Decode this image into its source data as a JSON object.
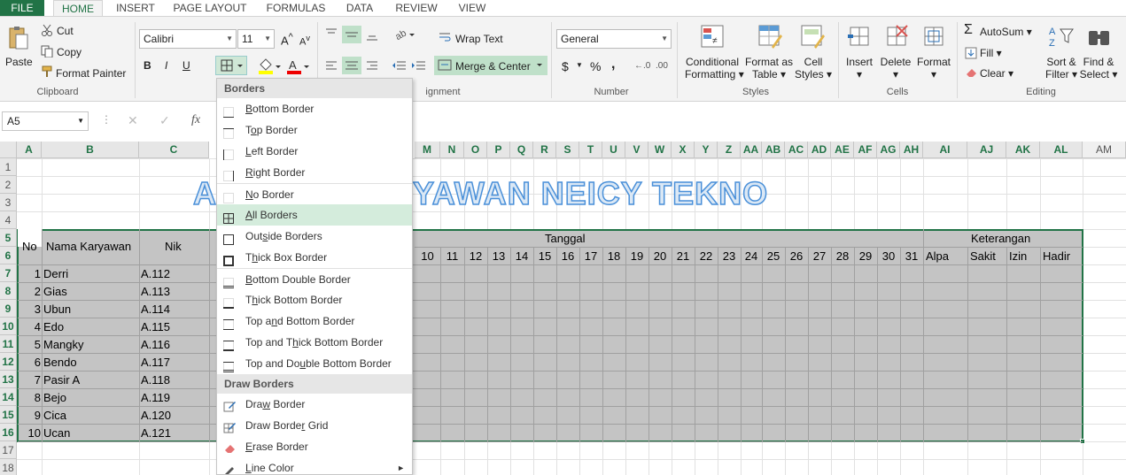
{
  "tabs": {
    "file": "FILE",
    "home": "HOME",
    "insert": "INSERT",
    "page_layout": "PAGE LAYOUT",
    "formulas": "FORMULAS",
    "data": "DATA",
    "review": "REVIEW",
    "view": "VIEW"
  },
  "clipboard": {
    "paste": "Paste",
    "cut": "Cut",
    "copy": "Copy",
    "format_painter": "Format Painter",
    "label": "Clipboard"
  },
  "font": {
    "name": "Calibri",
    "size": "11",
    "label": "Font",
    "bold": "B",
    "italic": "I",
    "underline": "U"
  },
  "alignment": {
    "wrap": "Wrap Text",
    "merge": "Merge & Center",
    "label": "Alignment"
  },
  "number": {
    "format": "General",
    "currency": "$",
    "percent": "%",
    "comma": ",",
    "label": "Number"
  },
  "styles": {
    "conditional": "Conditional",
    "conditional2": "Formatting",
    "format_as": "Format as",
    "format_as2": "Table",
    "cell": "Cell",
    "cell2": "Styles",
    "label": "Styles"
  },
  "cells": {
    "insert": "Insert",
    "delete": "Delete",
    "format": "Format",
    "label": "Cells"
  },
  "editing": {
    "autosum": "AutoSum",
    "fill": "Fill",
    "clear": "Clear",
    "sort": "Sort &",
    "sort2": "Filter",
    "find": "Find &",
    "find2": "Select",
    "label": "Editing"
  },
  "formula_bar": {
    "name_box": "A5",
    "fx": "fx"
  },
  "columns": [
    "A",
    "B",
    "C",
    "M",
    "N",
    "O",
    "P",
    "Q",
    "R",
    "S",
    "T",
    "U",
    "V",
    "W",
    "X",
    "Y",
    "Z",
    "AA",
    "AB",
    "AC",
    "AD",
    "AE",
    "AF",
    "AG",
    "AH",
    "AI",
    "AJ",
    "AK",
    "AL",
    "AM"
  ],
  "rows": [
    "1",
    "2",
    "3",
    "4",
    "5",
    "6",
    "7",
    "8",
    "9",
    "10",
    "11",
    "12",
    "13",
    "14",
    "15",
    "16",
    "17",
    "18"
  ],
  "sheet": {
    "title_left": "A",
    "title_right": "YAWAN NEICY TEKNO",
    "hdr_no": "No",
    "hdr_nama": "Nama Karyawan",
    "hdr_nik": "Nik",
    "hdr_tanggal": "Tanggal",
    "hdr_keterangan": "Keterangan",
    "days": [
      "10",
      "11",
      "12",
      "13",
      "14",
      "15",
      "16",
      "17",
      "18",
      "19",
      "20",
      "21",
      "22",
      "23",
      "24",
      "25",
      "26",
      "27",
      "28",
      "29",
      "30",
      "31"
    ],
    "ket": [
      "Alpa",
      "Sakit",
      "Izin",
      "Hadir"
    ],
    "employees": [
      {
        "no": "1",
        "nama": "Derri",
        "nik": "A.112"
      },
      {
        "no": "2",
        "nama": "Gias",
        "nik": "A.113"
      },
      {
        "no": "3",
        "nama": "Ubun",
        "nik": "A.114"
      },
      {
        "no": "4",
        "nama": "Edo",
        "nik": "A.115"
      },
      {
        "no": "5",
        "nama": "Mangky",
        "nik": "A.116"
      },
      {
        "no": "6",
        "nama": "Bendo",
        "nik": "A.117"
      },
      {
        "no": "7",
        "nama": "Pasir A",
        "nik": "A.118"
      },
      {
        "no": "8",
        "nama": "Bejo",
        "nik": "A.119"
      },
      {
        "no": "9",
        "nama": "Cica",
        "nik": "A.120"
      },
      {
        "no": "10",
        "nama": "Ucan",
        "nik": "A.121"
      }
    ]
  },
  "menu": {
    "borders_header": "Borders",
    "items": [
      "Bottom Border",
      "Top Border",
      "Left Border",
      "Right Border",
      "No Border",
      "All Borders",
      "Outside Borders",
      "Thick Box Border",
      "Bottom Double Border",
      "Thick Bottom Border",
      "Top and Bottom Border",
      "Top and Thick Bottom Border",
      "Top and Double Bottom Border"
    ],
    "draw_header": "Draw Borders",
    "draw_items": [
      "Draw Border",
      "Draw Border Grid",
      "Erase Border",
      "Line Color"
    ]
  },
  "colors": {
    "excel_green": "#217346",
    "selection_gray": "#c4c4c4",
    "highlight": "#d4ecdc"
  }
}
